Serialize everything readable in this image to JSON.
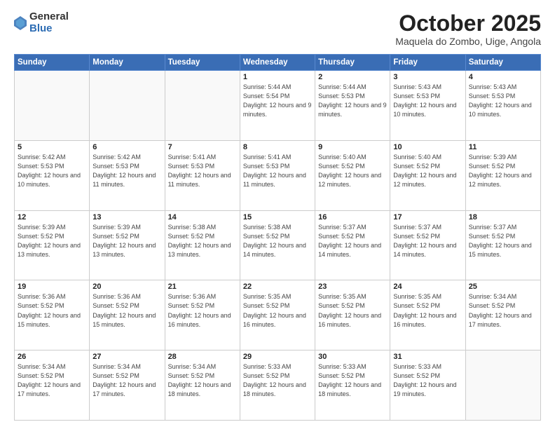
{
  "logo": {
    "general": "General",
    "blue": "Blue"
  },
  "header": {
    "month": "October 2025",
    "location": "Maquela do Zombo, Uige, Angola"
  },
  "weekdays": [
    "Sunday",
    "Monday",
    "Tuesday",
    "Wednesday",
    "Thursday",
    "Friday",
    "Saturday"
  ],
  "weeks": [
    [
      {
        "date": "",
        "info": ""
      },
      {
        "date": "",
        "info": ""
      },
      {
        "date": "",
        "info": ""
      },
      {
        "date": "1",
        "info": "Sunrise: 5:44 AM\nSunset: 5:54 PM\nDaylight: 12 hours\nand 9 minutes."
      },
      {
        "date": "2",
        "info": "Sunrise: 5:44 AM\nSunset: 5:53 PM\nDaylight: 12 hours\nand 9 minutes."
      },
      {
        "date": "3",
        "info": "Sunrise: 5:43 AM\nSunset: 5:53 PM\nDaylight: 12 hours\nand 10 minutes."
      },
      {
        "date": "4",
        "info": "Sunrise: 5:43 AM\nSunset: 5:53 PM\nDaylight: 12 hours\nand 10 minutes."
      }
    ],
    [
      {
        "date": "5",
        "info": "Sunrise: 5:42 AM\nSunset: 5:53 PM\nDaylight: 12 hours\nand 10 minutes."
      },
      {
        "date": "6",
        "info": "Sunrise: 5:42 AM\nSunset: 5:53 PM\nDaylight: 12 hours\nand 11 minutes."
      },
      {
        "date": "7",
        "info": "Sunrise: 5:41 AM\nSunset: 5:53 PM\nDaylight: 12 hours\nand 11 minutes."
      },
      {
        "date": "8",
        "info": "Sunrise: 5:41 AM\nSunset: 5:53 PM\nDaylight: 12 hours\nand 11 minutes."
      },
      {
        "date": "9",
        "info": "Sunrise: 5:40 AM\nSunset: 5:52 PM\nDaylight: 12 hours\nand 12 minutes."
      },
      {
        "date": "10",
        "info": "Sunrise: 5:40 AM\nSunset: 5:52 PM\nDaylight: 12 hours\nand 12 minutes."
      },
      {
        "date": "11",
        "info": "Sunrise: 5:39 AM\nSunset: 5:52 PM\nDaylight: 12 hours\nand 12 minutes."
      }
    ],
    [
      {
        "date": "12",
        "info": "Sunrise: 5:39 AM\nSunset: 5:52 PM\nDaylight: 12 hours\nand 13 minutes."
      },
      {
        "date": "13",
        "info": "Sunrise: 5:39 AM\nSunset: 5:52 PM\nDaylight: 12 hours\nand 13 minutes."
      },
      {
        "date": "14",
        "info": "Sunrise: 5:38 AM\nSunset: 5:52 PM\nDaylight: 12 hours\nand 13 minutes."
      },
      {
        "date": "15",
        "info": "Sunrise: 5:38 AM\nSunset: 5:52 PM\nDaylight: 12 hours\nand 14 minutes."
      },
      {
        "date": "16",
        "info": "Sunrise: 5:37 AM\nSunset: 5:52 PM\nDaylight: 12 hours\nand 14 minutes."
      },
      {
        "date": "17",
        "info": "Sunrise: 5:37 AM\nSunset: 5:52 PM\nDaylight: 12 hours\nand 14 minutes."
      },
      {
        "date": "18",
        "info": "Sunrise: 5:37 AM\nSunset: 5:52 PM\nDaylight: 12 hours\nand 15 minutes."
      }
    ],
    [
      {
        "date": "19",
        "info": "Sunrise: 5:36 AM\nSunset: 5:52 PM\nDaylight: 12 hours\nand 15 minutes."
      },
      {
        "date": "20",
        "info": "Sunrise: 5:36 AM\nSunset: 5:52 PM\nDaylight: 12 hours\nand 15 minutes."
      },
      {
        "date": "21",
        "info": "Sunrise: 5:36 AM\nSunset: 5:52 PM\nDaylight: 12 hours\nand 16 minutes."
      },
      {
        "date": "22",
        "info": "Sunrise: 5:35 AM\nSunset: 5:52 PM\nDaylight: 12 hours\nand 16 minutes."
      },
      {
        "date": "23",
        "info": "Sunrise: 5:35 AM\nSunset: 5:52 PM\nDaylight: 12 hours\nand 16 minutes."
      },
      {
        "date": "24",
        "info": "Sunrise: 5:35 AM\nSunset: 5:52 PM\nDaylight: 12 hours\nand 16 minutes."
      },
      {
        "date": "25",
        "info": "Sunrise: 5:34 AM\nSunset: 5:52 PM\nDaylight: 12 hours\nand 17 minutes."
      }
    ],
    [
      {
        "date": "26",
        "info": "Sunrise: 5:34 AM\nSunset: 5:52 PM\nDaylight: 12 hours\nand 17 minutes."
      },
      {
        "date": "27",
        "info": "Sunrise: 5:34 AM\nSunset: 5:52 PM\nDaylight: 12 hours\nand 17 minutes."
      },
      {
        "date": "28",
        "info": "Sunrise: 5:34 AM\nSunset: 5:52 PM\nDaylight: 12 hours\nand 18 minutes."
      },
      {
        "date": "29",
        "info": "Sunrise: 5:33 AM\nSunset: 5:52 PM\nDaylight: 12 hours\nand 18 minutes."
      },
      {
        "date": "30",
        "info": "Sunrise: 5:33 AM\nSunset: 5:52 PM\nDaylight: 12 hours\nand 18 minutes."
      },
      {
        "date": "31",
        "info": "Sunrise: 5:33 AM\nSunset: 5:52 PM\nDaylight: 12 hours\nand 19 minutes."
      },
      {
        "date": "",
        "info": ""
      }
    ]
  ]
}
